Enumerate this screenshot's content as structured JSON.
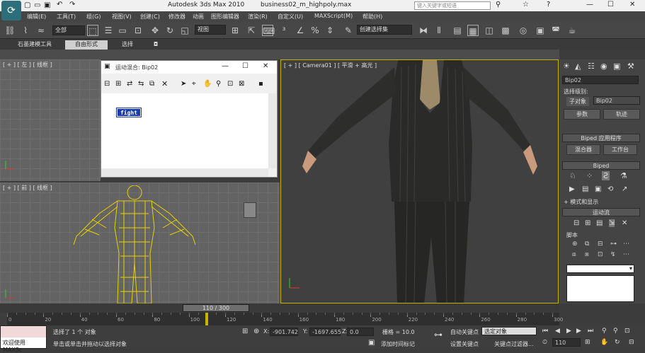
{
  "titlebar": {
    "app": "Autodesk 3ds Max  2010",
    "file": "business02_m_highpoly.max",
    "search_placeholder": "键入关键字或短语",
    "window_buttons": [
      "—",
      "☐",
      "✕"
    ]
  },
  "menu": [
    "编辑(E)",
    "工具(T)",
    "组(G)",
    "视图(V)",
    "创建(C)",
    "修改器",
    "动画",
    "图形编辑器",
    "渲染(R)",
    "自定义(U)",
    "MAXScript(M)",
    "帮助(H)"
  ],
  "toolbar": {
    "selection_filter": "全部",
    "ref_coord": "视图",
    "named_selection": "创建选择集"
  },
  "ribbon": {
    "tabs": [
      "石墨建模工具",
      "自由形式",
      "选择",
      "◘"
    ]
  },
  "viewports": {
    "top_left_label": "[ + ] [ 左 ] [ 线框 ]",
    "bottom_left_label": "[ + ] [ 前 ] [ 线框 ]",
    "camera_label": "[ + ] [ Camera01 ] [ 平滑 + 高光 ]"
  },
  "dialog": {
    "title": "运动混合: Bip02",
    "clip_label": "fight"
  },
  "command_panel": {
    "object_name": "Bip02",
    "selection_level_label": "选择级别:",
    "sub_object": "子对象",
    "sub_value": "Bip02",
    "btn_params": "参数",
    "btn_track": "轨迹",
    "rollout_apps": "Biped 应用程序",
    "btn_mixer": "混合器",
    "btn_workbench": "工作台",
    "rollout_biped": "Biped",
    "rollout_modes": "+ 模式和显示",
    "rollout_motion_flow": "运动流",
    "script_label": "脚本"
  },
  "timeline": {
    "frame": "110 / 300",
    "ticks": [
      "0",
      "20",
      "40",
      "60",
      "80",
      "100",
      "120",
      "140",
      "160",
      "180",
      "200",
      "220",
      "240",
      "260",
      "280",
      "300"
    ],
    "current_frame": 110,
    "total_frames": 300
  },
  "status": {
    "welcome": "欢迎使用  MAXSc",
    "selected": "选择了 1 个 对象",
    "hint": "单击或单击并拖动以选择对象",
    "x_label": "X:",
    "x_value": "-901.742",
    "y_label": "Y:",
    "y_value": "-1697.655",
    "z_label": "Z:",
    "z_value": "0.0",
    "grid": "栅格 = 10.0",
    "add_time_tag": "添加时间标记",
    "auto_key": "自动关键点",
    "set_key": "设置关键点",
    "key_filter": "选定对象",
    "key_filter_btn": "关键点过滤器...",
    "frame_field": "110"
  },
  "colors": {
    "wireframe": "#e8d200",
    "timeline_slider": "#c8b400",
    "viewport_bg": "#636363",
    "camera_bg": "#404040"
  }
}
